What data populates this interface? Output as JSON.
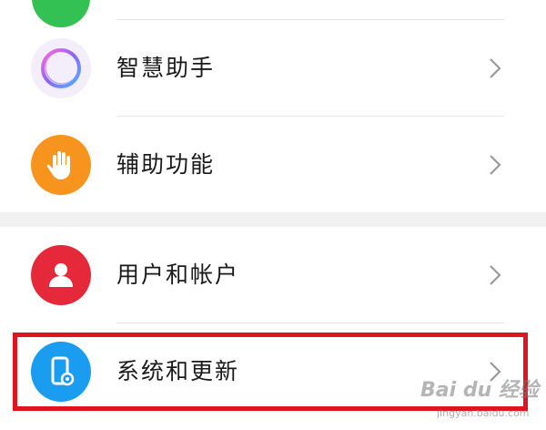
{
  "settings": {
    "items": [
      {
        "label": "智慧助手",
        "icon": "assistant-ring-icon"
      },
      {
        "label": "辅助功能",
        "icon": "hand-icon",
        "color": "#f7941d"
      },
      {
        "label": "用户和帐户",
        "icon": "user-icon",
        "color": "#e5283a"
      },
      {
        "label": "系统和更新",
        "icon": "phone-settings-icon",
        "color": "#1a9cf0"
      }
    ]
  },
  "watermark": {
    "brand": "Bai du 经验",
    "url": "jingyan.baidu.com"
  },
  "colors": {
    "highlight": "#e0141e",
    "section_gap": "#f1f1f1"
  }
}
